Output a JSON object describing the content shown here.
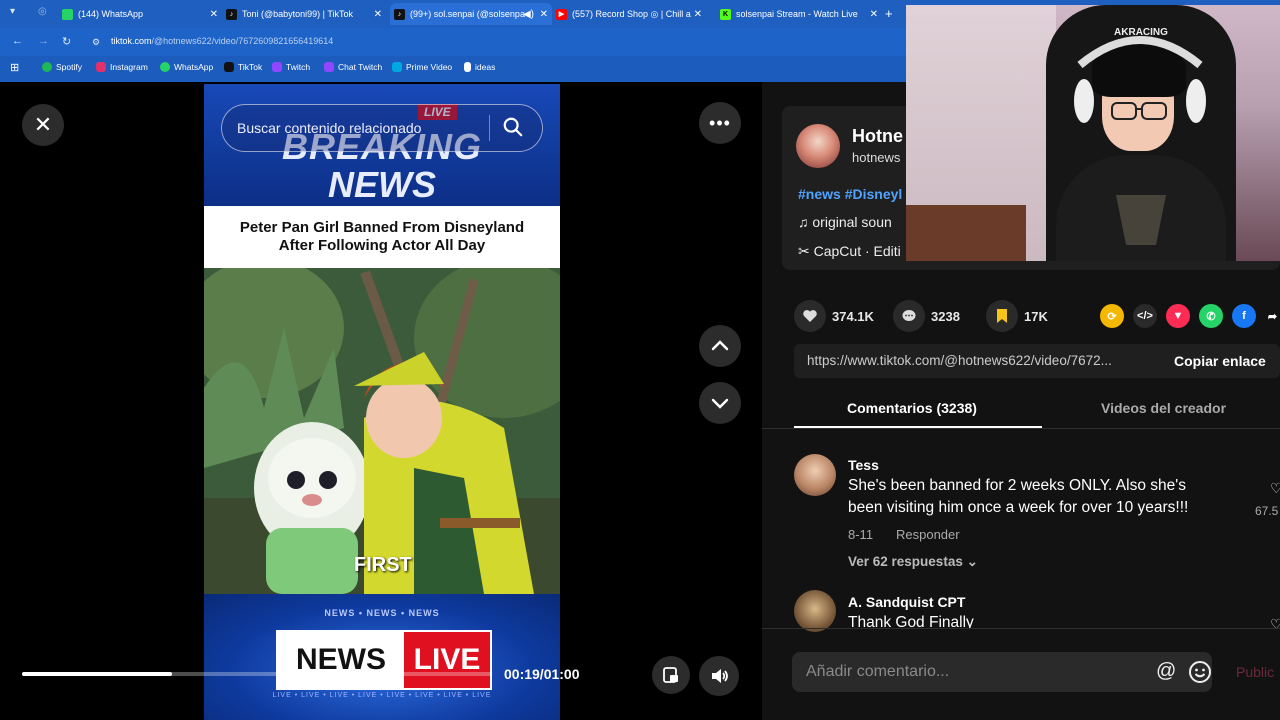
{
  "browser": {
    "tabs": [
      {
        "label": "(144) WhatsApp",
        "color": "#25d366",
        "active": false
      },
      {
        "label": "Toni (@babytoni99) | TikTok",
        "color": "#111111",
        "active": false
      },
      {
        "label": "(99+) sol.senpai (@solsenpa",
        "color": "#111111",
        "active": true
      },
      {
        "label": "(557) Record Shop ◎ | Chill a",
        "color": "#ff0000",
        "active": false
      },
      {
        "label": "solsenpai Stream - Watch Live",
        "color": "#53fc18",
        "active": false
      }
    ],
    "url_host": "tiktok.com",
    "url_path": "/@hotnews622/video/7672609821656419614",
    "bookmarks": [
      {
        "label": "Spotify",
        "color": "#1db954"
      },
      {
        "label": "Instagram",
        "color": "#e1306c"
      },
      {
        "label": "WhatsApp",
        "color": "#25d366"
      },
      {
        "label": "TikTok",
        "color": "#111111"
      },
      {
        "label": "Twitch",
        "color": "#9146ff"
      },
      {
        "label": "Chat Twitch",
        "color": "#9146ff"
      },
      {
        "label": "Prime Video",
        "color": "#00a8e1"
      },
      {
        "label": "ideas",
        "color": "#ffffff"
      }
    ]
  },
  "video": {
    "search_placeholder": "Buscar contenido relacionado",
    "live_tag": "LIVE",
    "breaking": "BREAKING",
    "news": "NEWS",
    "headline_line1": "Peter Pan Girl Banned From Disneyland",
    "headline_line2": "After Following Actor All Day",
    "caption_word": "FIRST",
    "small_news": "NEWS • NEWS • NEWS",
    "news_live_1": "NEWS",
    "news_live_2": "LIVE",
    "live_strip": "LIVE • LIVE • LIVE • LIVE • LIVE • LIVE • LIVE • LIVE",
    "timecode": "00:19/01:00",
    "progress": 0.32
  },
  "post": {
    "author_name": "Hotne",
    "author_handle": "hotnews",
    "hashtags": "#news #Disneyl",
    "sound": "original soun",
    "capcut": "CapCut · Editi",
    "likes": "374.1K",
    "comments": "3238",
    "saves": "17K",
    "link": "https://www.tiktok.com/@hotnews622/video/7672...",
    "copy_link": "Copiar enlace",
    "tab_comments": "Comentarios (3238)",
    "tab_creator": "Videos del creador"
  },
  "comments": [
    {
      "name": "Tess",
      "text_line1": "She's been banned for 2 weeks ONLY. Also she's",
      "text_line2": "been visiting him once a week for over 10 years!!!",
      "date": "8-11",
      "reply": "Responder",
      "replies": "Ver 62 respuestas",
      "likes": "67.5"
    },
    {
      "name": "A. Sandquist CPT",
      "text_line1": "Thank God Finally"
    }
  ],
  "composer": {
    "placeholder": "Añadir comentario...",
    "publish": "Public"
  },
  "webcam": {
    "chair_brand": "AKRACING"
  }
}
